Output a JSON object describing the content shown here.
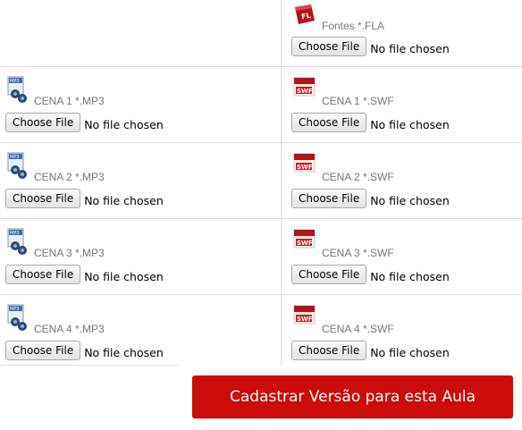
{
  "colors": {
    "accent": "#cc0b0b",
    "divider": "#dddddd",
    "label": "#777777"
  },
  "file_button_label": "Choose File",
  "no_file_text": "No file chosen",
  "rows": [
    {
      "left": null,
      "right": {
        "icon": "flash-fla-icon",
        "icon_text": "FL",
        "label": "Fontes *.FLA"
      }
    },
    {
      "left": {
        "icon": "mp3-file-icon",
        "icon_text": "MP3",
        "label": "CENA 1 *.MP3"
      },
      "right": {
        "icon": "swf-file-icon",
        "icon_text": "SWF",
        "label": "CENA 1 *.SWF"
      }
    },
    {
      "left": {
        "icon": "mp3-file-icon",
        "icon_text": "MP3",
        "label": "CENA 2 *.MP3"
      },
      "right": {
        "icon": "swf-file-icon",
        "icon_text": "SWF",
        "label": "CENA 2 *.SWF"
      }
    },
    {
      "left": {
        "icon": "mp3-file-icon",
        "icon_text": "MP3",
        "label": "CENA 3 *.MP3"
      },
      "right": {
        "icon": "swf-file-icon",
        "icon_text": "SWF",
        "label": "CENA 3 *.SWF"
      }
    },
    {
      "left": {
        "icon": "mp3-file-icon",
        "icon_text": "MP3",
        "label": "CENA 4 *.MP3"
      },
      "right": {
        "icon": "swf-file-icon",
        "icon_text": "SWF",
        "label": "CENA 4 *.SWF"
      }
    }
  ],
  "submit_label": "Cadastrar Versão para esta Aula"
}
